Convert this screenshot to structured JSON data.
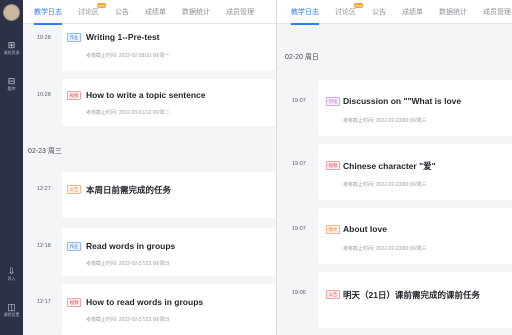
{
  "left": {
    "sidebar": {
      "items": [
        {
          "icon": "⊞",
          "label": "课程资源"
        },
        {
          "icon": "⊟",
          "label": "题库"
        },
        {
          "icon": "⇩",
          "label": "导入"
        },
        {
          "icon": "◫",
          "label": "课程设置"
        }
      ]
    },
    "tabs": [
      {
        "label": "教学日志",
        "active": true
      },
      {
        "label": "讨论区",
        "badge": "new"
      },
      {
        "label": "公告"
      },
      {
        "label": "成绩单"
      },
      {
        "label": "数据统计"
      },
      {
        "label": "成员管理"
      }
    ],
    "date_groups": [
      "02-23 周三"
    ],
    "entries": [
      {
        "time": "10:28",
        "tag": "作业",
        "tag_color": "blue",
        "title": "Writing 1--Pre-test",
        "sub": "考核截止时间:  2022-02-28/10:00/周一"
      },
      {
        "time": "10:28",
        "tag": "视频",
        "tag_color": "red",
        "title": "How to write a topic sentence",
        "sub": "考核截止时间:  2022-03-01/12:00/周二"
      },
      {
        "time": "12:27",
        "tag": "公告",
        "tag_color": "orange",
        "title": "本周日前需完成的任务",
        "sub": ""
      },
      {
        "time": "12:18",
        "tag": "作业",
        "tag_color": "blue",
        "title": "Read words in groups",
        "sub": "考核截止时间:  2022-02-27/23:00/周日"
      },
      {
        "time": "12:17",
        "tag": "视频",
        "tag_color": "red",
        "title": "How to read words in groups",
        "sub": "考核截止时间:  2022-02-27/23:00/周日"
      }
    ]
  },
  "right": {
    "tabs": [
      {
        "label": "教学日志",
        "active": true
      },
      {
        "label": "讨论区",
        "badge": "new"
      },
      {
        "label": "公告"
      },
      {
        "label": "成绩单"
      },
      {
        "label": "数据统计"
      },
      {
        "label": "成员管理"
      }
    ],
    "date_groups": [
      "02-20 周日"
    ],
    "entries": [
      {
        "time": "19:07",
        "tag": "讨论",
        "tag_color": "purple",
        "title": "Discussion on \"\"What is love",
        "sub": "考核截止时间:  2022-02-23/00:00/周三"
      },
      {
        "time": "19:07",
        "tag": "视频",
        "tag_color": "red",
        "title": "Chinese character \"爱\"",
        "sub": "考核截止时间:  2022-02-23/00:00/周三"
      },
      {
        "time": "19:07",
        "tag": "图文",
        "tag_color": "orange",
        "title": "About love",
        "sub": "考核截止时间:  2022-02-23/00:00/周三"
      },
      {
        "time": "19:06",
        "tag": "公告",
        "tag_color": "red",
        "title": "明天（21日）课前需完成的课前任务",
        "sub": ""
      }
    ]
  }
}
